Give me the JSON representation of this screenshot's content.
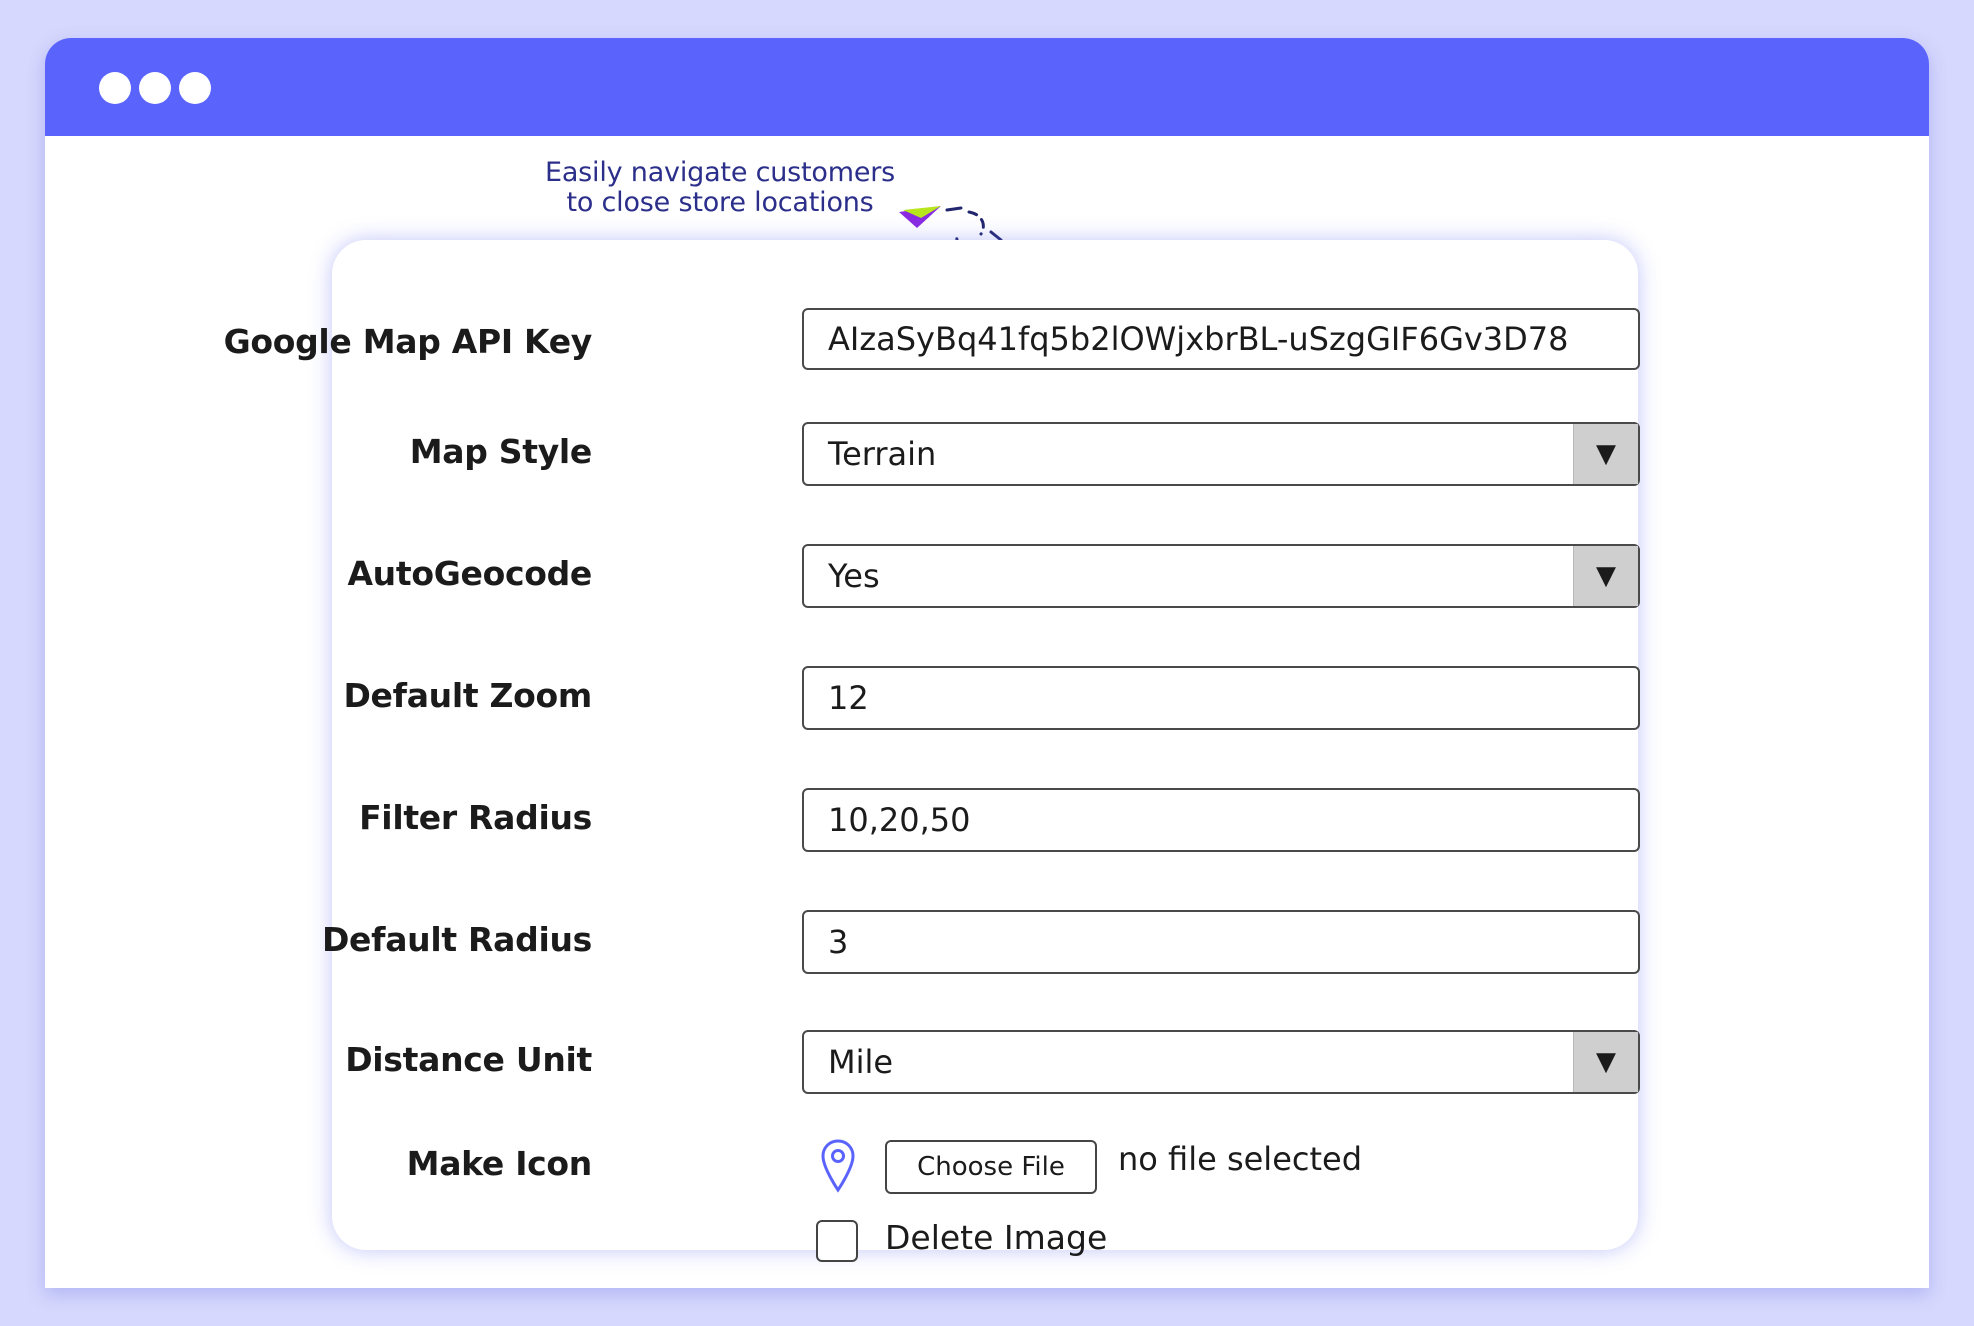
{
  "window": {
    "accent": "#5a64fd"
  },
  "callout": {
    "line1": "Easily navigate customers",
    "line2": "to close store locations",
    "icon": "paper-plane-icon"
  },
  "form": {
    "api_key": {
      "label": "Google Map API Key",
      "value": "AIzaSyBq41fq5b2lOWjxbrBL-uSzgGIF6Gv3D78"
    },
    "map_style": {
      "label": "Map Style",
      "value": "Terrain"
    },
    "auto_geocode": {
      "label": "AutoGeocode",
      "value": "Yes"
    },
    "default_zoom": {
      "label": "Default Zoom",
      "value": "12"
    },
    "filter_radius": {
      "label": "Filter Radius",
      "value": "10,20,50"
    },
    "default_radius": {
      "label": "Default Radius",
      "value": "3"
    },
    "distance_unit": {
      "label": "Distance Unit",
      "value": "Mile"
    },
    "make_icon": {
      "label": "Make Icon",
      "choose_file": "Choose File",
      "no_file": "no file selected",
      "delete_image": "Delete Image",
      "icon": "map-pin-icon"
    },
    "dropdown_arrow": "▼"
  }
}
